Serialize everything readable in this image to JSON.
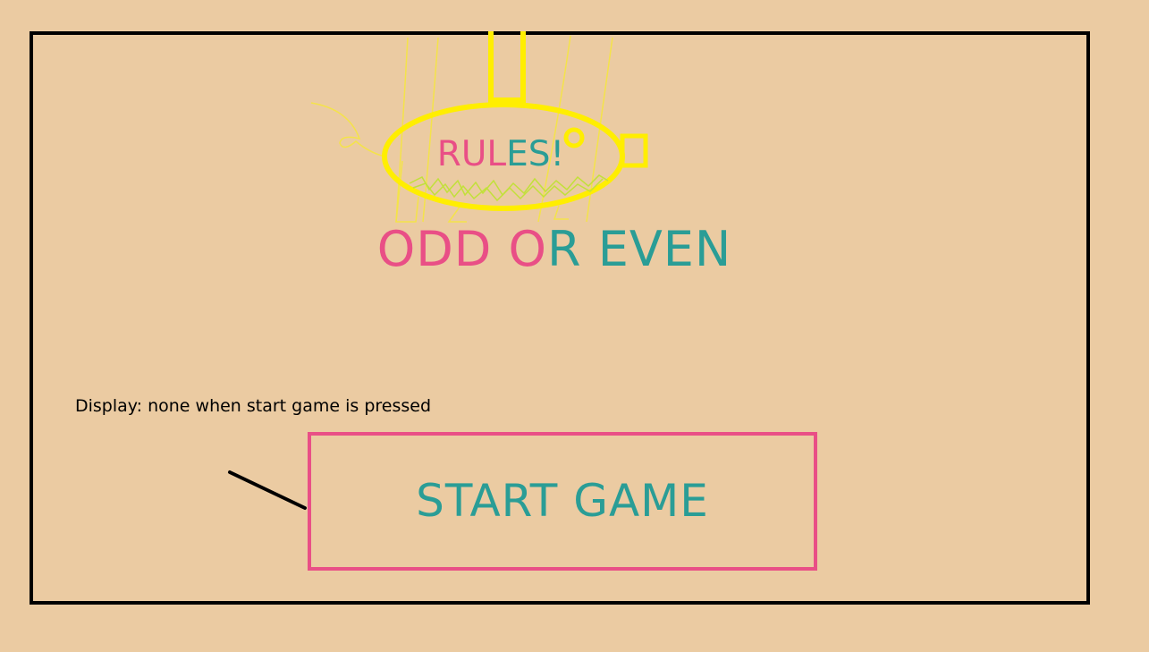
{
  "rules": {
    "parts": [
      {
        "text": "RUL",
        "color": "#e94f86"
      },
      {
        "text": "ES!",
        "color": "#2a9d96"
      }
    ]
  },
  "title": {
    "parts": [
      {
        "text": "ODD ",
        "color": "#e94f86"
      },
      {
        "text": "O",
        "color": "#e94f86"
      },
      {
        "text": "R EVEN",
        "color": "#2a9d96"
      }
    ]
  },
  "note": "Display: none when start game is pressed",
  "start_button": {
    "label": "START GAME"
  },
  "colors": {
    "background": "#ebcba2",
    "frame": "#000000",
    "pink": "#e94f86",
    "teal": "#2a9d96",
    "pig_outline": "#ffee00",
    "scribble": "#c2e03a"
  }
}
